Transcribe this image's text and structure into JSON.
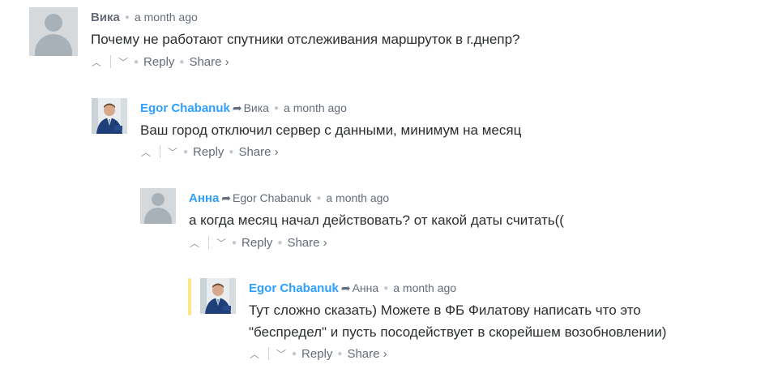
{
  "comments": [
    {
      "author": "Вика",
      "reply_to": "",
      "time": "a month ago",
      "message": "Почему не работают спутники отслеживания маршруток в г.днепр?",
      "reply_label": "Reply",
      "share_label": "Share ›",
      "avatar": "default-avatar"
    },
    {
      "author": "Egor Chabanuk",
      "reply_to": "Вика",
      "time": "a month ago",
      "message": "Ваш город отключил сервер с данными, минимум на месяц",
      "reply_label": "Reply",
      "share_label": "Share ›",
      "avatar": "photo-avatar"
    },
    {
      "author": "Анна",
      "reply_to": "Egor Chabanuk",
      "time": "a month ago",
      "message": "а когда месяц начал действовать? от какой даты считать((",
      "reply_label": "Reply",
      "share_label": "Share ›",
      "avatar": "default-avatar"
    },
    {
      "author": "Egor Chabanuk",
      "reply_to": "Анна",
      "time": "a month ago",
      "message_lines": [
        "Тут сложно сказать) Можете в ФБ Филатову написать что это",
        "\"беспредел\" и пусть посодействует в скорейшем возобновлении)"
      ],
      "reply_label": "Reply",
      "share_label": "Share ›",
      "avatar": "photo-avatar"
    }
  ],
  "colors": {
    "link_author": "#2e9fff",
    "muted": "#656c7a",
    "text": "#2a2e2e",
    "highlight": "#ffe680"
  }
}
